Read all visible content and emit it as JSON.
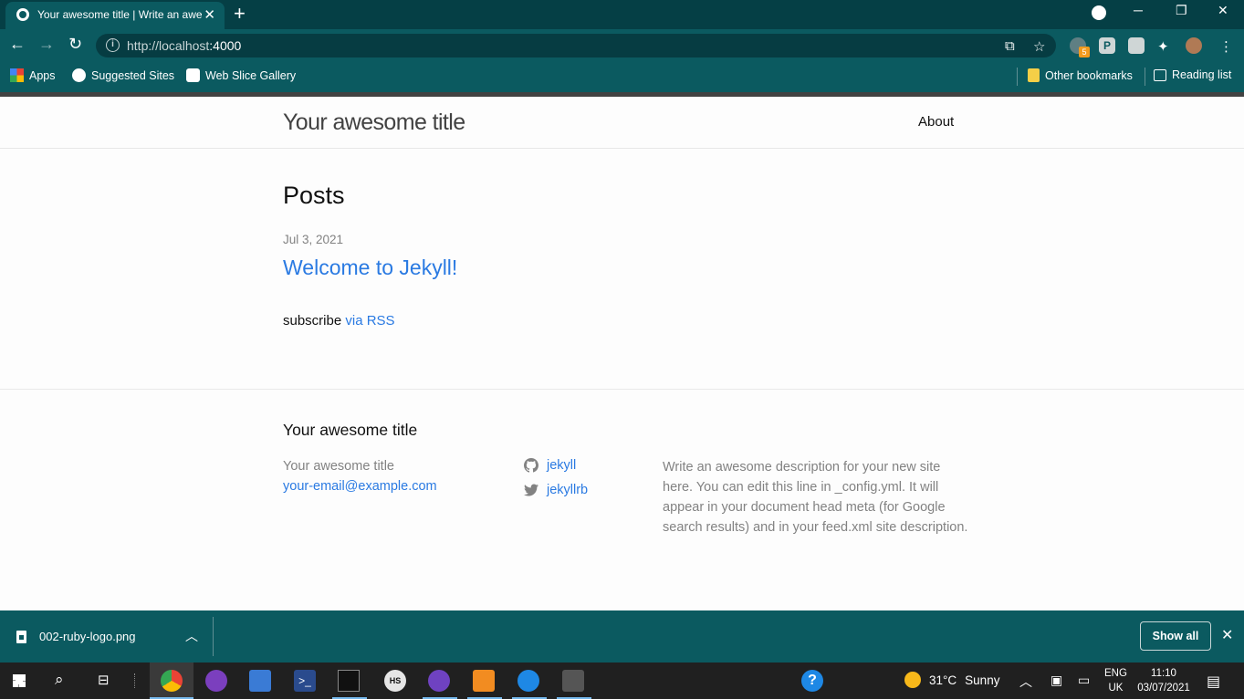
{
  "browser": {
    "tab_title": "Your awesome title | Write an awesome description",
    "url_host": "http://localhost",
    "url_port": ":4000",
    "bookmarks": [
      "Apps",
      "Suggested Sites",
      "Web Slice Gallery"
    ],
    "other_bookmarks": "Other bookmarks",
    "reading_list": "Reading list",
    "extension_badge": "5"
  },
  "site": {
    "title": "Your awesome title",
    "nav": [
      "About"
    ]
  },
  "main": {
    "heading": "Posts",
    "posts": [
      {
        "date": "Jul 3, 2021",
        "title": "Welcome to Jekyll!"
      }
    ],
    "subscribe_text": "subscribe",
    "subscribe_link": "via RSS"
  },
  "footer": {
    "heading": "Your awesome title",
    "name": "Your awesome title",
    "email": "your-email@example.com",
    "github": "jekyll",
    "twitter": "jekyllrb",
    "description": "Write an awesome description for your new site here. You can edit this line in _config.yml. It will appear in your document head meta (for Google search results) and in your feed.xml site description."
  },
  "downloads": {
    "file": "002-ruby-logo.png",
    "show_all": "Show all"
  },
  "taskbar": {
    "temperature": "31°C",
    "weather": "Sunny",
    "lang_top": "ENG",
    "lang_bottom": "UK",
    "time": "11:10",
    "date": "03/07/2021"
  }
}
